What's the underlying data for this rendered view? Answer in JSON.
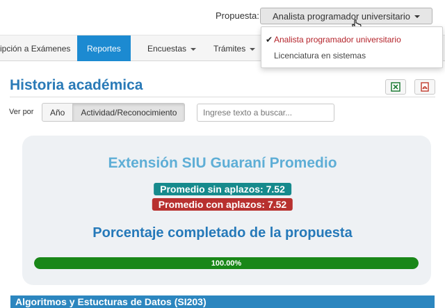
{
  "header": {
    "propuesta_label": "Propuesta:",
    "propuesta_selected": "Analista programador universitario"
  },
  "nav": {
    "items": [
      {
        "label": "ipción a Exámenes"
      },
      {
        "label": "Reportes",
        "active": true
      },
      {
        "label": "Encuestas"
      },
      {
        "label": "Trámites"
      }
    ]
  },
  "dropdown": {
    "options": [
      {
        "label": "Analista programador universitario",
        "selected": true
      },
      {
        "label": "Licenciatura en sistemas"
      }
    ]
  },
  "page": {
    "title": "Historia académica",
    "export_icons": [
      "excel-icon",
      "pdf-icon"
    ]
  },
  "filters": {
    "ver_por_label": "Ver por",
    "options": [
      "Año",
      "Actividad/Reconocimiento"
    ],
    "active": "Actividad/Reconocimiento",
    "search_placeholder": "Ingrese texto a buscar..."
  },
  "summary": {
    "title": "Extensión SIU Guaraní Promedio",
    "promedio_sin": "Promedio sin aplazos: 7.52",
    "promedio_con": "Promedio con aplazos: 7.52",
    "porcentaje_title": "Porcentaje completado de la propuesta",
    "progress_value": 100,
    "progress_label": "100.00%"
  },
  "subject": {
    "title": "Algoritmos y Estucturas de Datos (SI203)"
  },
  "colors": {
    "accent": "#1c8ad1",
    "title_blue": "#2a7ab7",
    "teal_badge": "#168a8c",
    "red_badge": "#b8312f",
    "progress_green": "#198718",
    "selected_option": "#b4232a"
  }
}
